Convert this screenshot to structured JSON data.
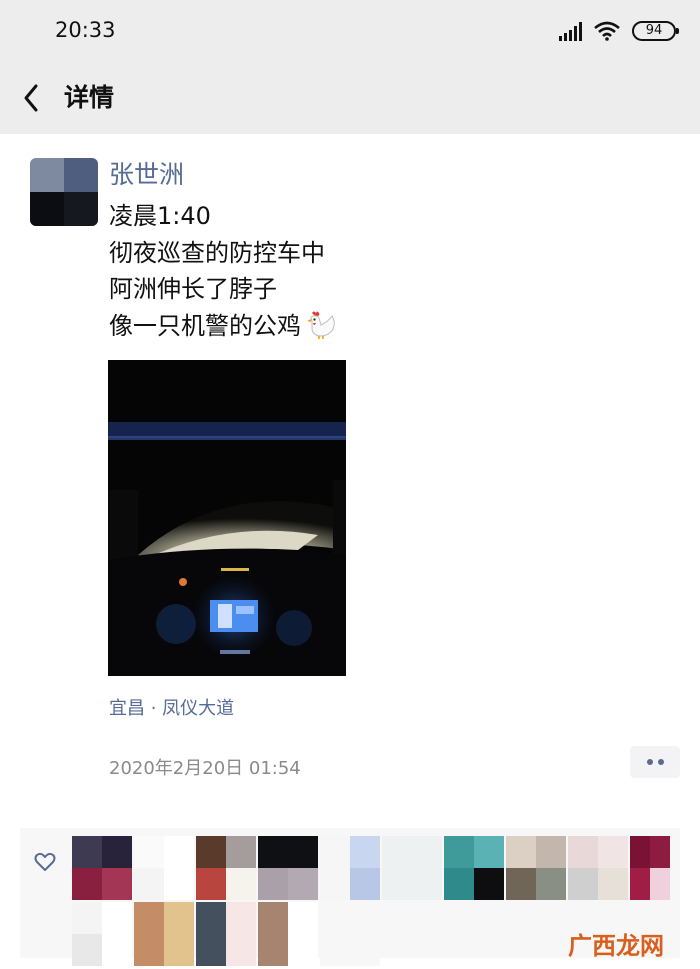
{
  "status_bar": {
    "time": "20:33",
    "battery": "94",
    "icons": [
      "signal-icon",
      "wifi-icon",
      "battery-icon"
    ]
  },
  "nav": {
    "back_icon": "chevron-left-icon",
    "title": "详情"
  },
  "post": {
    "author": "张世洲",
    "lines": [
      "凌晨1:40",
      "彻夜巡查的防控车中",
      "阿洲伸长了脖子",
      "像一只机警的公鸡"
    ],
    "emoji": "rooster-emoji",
    "photo": "night-car-dashboard-photo",
    "location": "宜昌 · 凤仪大道",
    "timestamp": "2020年2月20日 01:54",
    "more_icon": "more-dots-icon"
  },
  "likes": {
    "like_icon": "heart-outline-icon",
    "count_avatars": 15
  },
  "watermark": "广西龙网",
  "colors": {
    "link": "#576b95",
    "bar": "#ededed",
    "meta": "#8a8a8a",
    "watermark": "#d95f1d"
  }
}
